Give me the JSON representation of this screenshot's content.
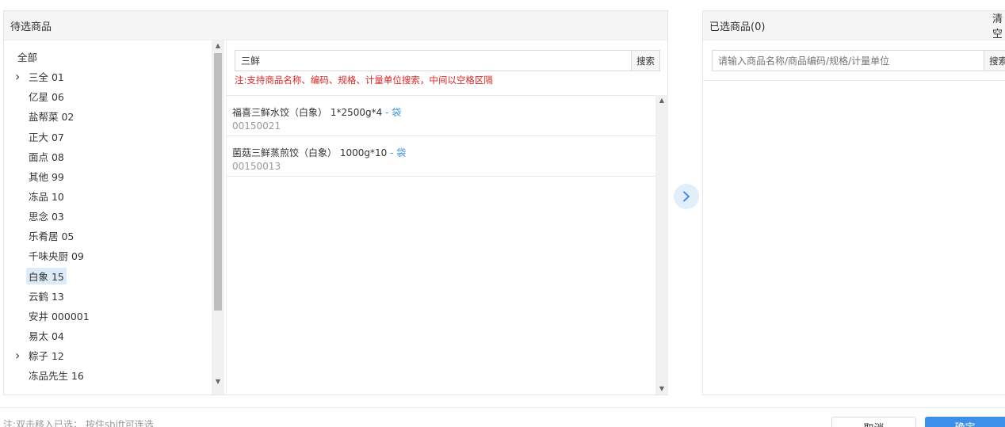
{
  "left_panel": {
    "title": "待选商品"
  },
  "tree": {
    "items": [
      {
        "label": "全部",
        "expandable": false,
        "root": true,
        "selected": false
      },
      {
        "label": "三全 01",
        "expandable": true,
        "root": false,
        "selected": false
      },
      {
        "label": "亿星 06",
        "expandable": false,
        "root": false,
        "selected": false
      },
      {
        "label": "盐帮菜 02",
        "expandable": false,
        "root": false,
        "selected": false
      },
      {
        "label": "正大 07",
        "expandable": false,
        "root": false,
        "selected": false
      },
      {
        "label": "面点 08",
        "expandable": false,
        "root": false,
        "selected": false
      },
      {
        "label": "其他 99",
        "expandable": false,
        "root": false,
        "selected": false
      },
      {
        "label": "冻品 10",
        "expandable": false,
        "root": false,
        "selected": false
      },
      {
        "label": "思念 03",
        "expandable": false,
        "root": false,
        "selected": false
      },
      {
        "label": "乐肴居 05",
        "expandable": false,
        "root": false,
        "selected": false
      },
      {
        "label": "千味央厨 09",
        "expandable": false,
        "root": false,
        "selected": false
      },
      {
        "label": "白象 15",
        "expandable": false,
        "root": false,
        "selected": true
      },
      {
        "label": "云鹤 13",
        "expandable": false,
        "root": false,
        "selected": false
      },
      {
        "label": "安井 000001",
        "expandable": false,
        "root": false,
        "selected": false
      },
      {
        "label": "易太 04",
        "expandable": false,
        "root": false,
        "selected": false
      },
      {
        "label": "粽子 12",
        "expandable": true,
        "root": false,
        "selected": false
      },
      {
        "label": "冻品先生 16",
        "expandable": false,
        "root": false,
        "selected": false
      }
    ]
  },
  "goods_search": {
    "value": "三鲜",
    "button_label": "搜索",
    "hint": "注:支持商品名称、编码、规格、计量单位搜索，中间以空格区隔"
  },
  "goods": [
    {
      "name": "福喜三鲜水饺（白象） 1*2500g*4",
      "unit": "- 袋",
      "code": "00150021"
    },
    {
      "name": "菌菇三鲜蒸煎饺（白象） 1000g*10",
      "unit": "- 袋",
      "code": "00150013"
    }
  ],
  "right_panel": {
    "title": "已选商品(0)",
    "clear_label": "清空",
    "search_placeholder": "请输入商品名称/商品编码/规格/计量单位",
    "search_button_label": "搜索"
  },
  "footer": {
    "note": "注:双击移入已选； 按住shift可连选",
    "cancel_label": "取消",
    "confirm_label": "确定"
  },
  "colors": {
    "accent": "#3d8fe8",
    "hint_red": "#e02424",
    "selected_bg": "#dceaf9"
  },
  "icons": {
    "tree_expand": "chevron-right-icon",
    "transfer": "chevron-right-icon"
  }
}
